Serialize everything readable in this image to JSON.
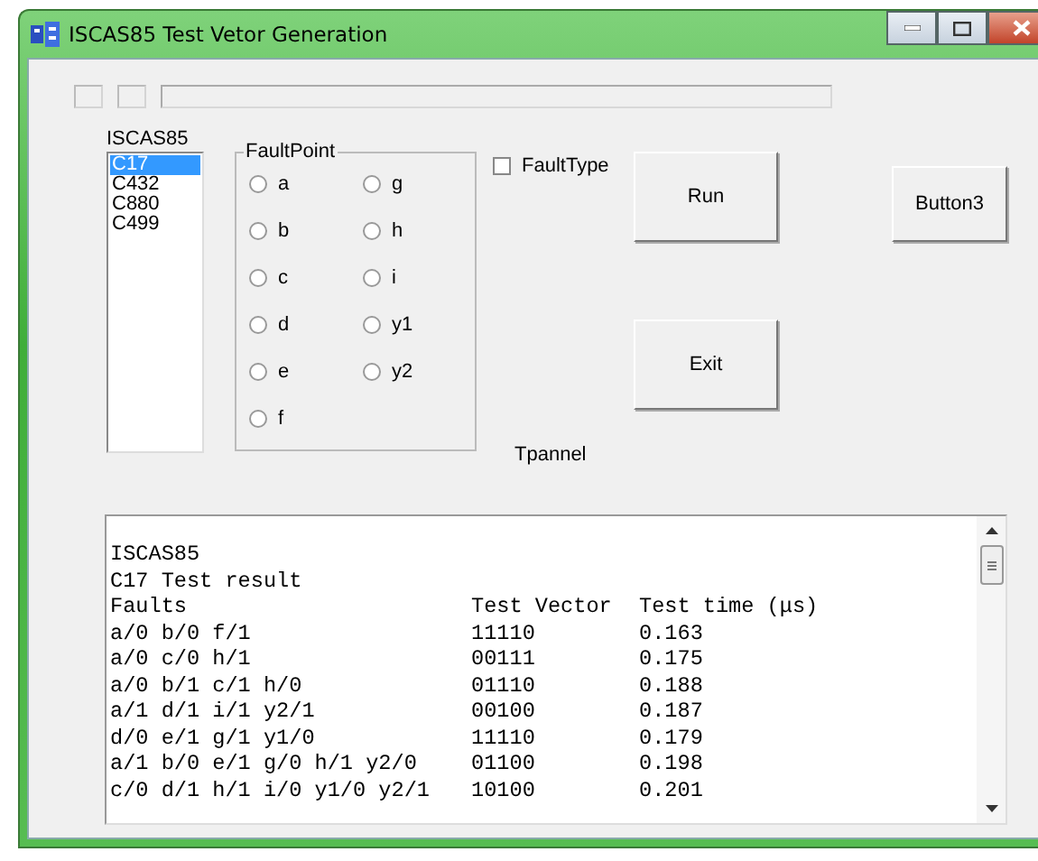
{
  "window": {
    "title": "ISCAS85 Test Vetor Generation"
  },
  "circuit_list": {
    "label": "ISCAS85",
    "items": [
      {
        "label": "C17",
        "selected": true
      },
      {
        "label": "C432",
        "selected": false
      },
      {
        "label": "C880",
        "selected": false
      },
      {
        "label": "C499",
        "selected": false
      }
    ]
  },
  "fault_point": {
    "title": "FaultPoint",
    "options": [
      {
        "label": "a",
        "selected": false
      },
      {
        "label": "g",
        "selected": false
      },
      {
        "label": "b",
        "selected": false
      },
      {
        "label": "h",
        "selected": false
      },
      {
        "label": "c",
        "selected": false
      },
      {
        "label": "i",
        "selected": false
      },
      {
        "label": "d",
        "selected": false
      },
      {
        "label": "y1",
        "selected": false
      },
      {
        "label": "e",
        "selected": false
      },
      {
        "label": "y2",
        "selected": false
      },
      {
        "label": "f",
        "selected": false
      }
    ]
  },
  "fault_type": {
    "label": "FaultType",
    "checked": false
  },
  "buttons": {
    "run": "Run",
    "exit": "Exit",
    "button3": "Button3"
  },
  "panel_label": "Tpannel",
  "output": {
    "lines": [
      "ISCAS85",
      "C17 Test result"
    ],
    "columns": [
      "Faults",
      "Test Vector",
      "Test time (μs)"
    ],
    "rows": [
      {
        "faults": "a/0 b/0 f/1",
        "vector": "11110",
        "time": "0.163"
      },
      {
        "faults": "a/0 c/0 h/1",
        "vector": "00111",
        "time": "0.175"
      },
      {
        "faults": "a/0 b/1 c/1 h/0",
        "vector": "01110",
        "time": "0.188"
      },
      {
        "faults": "a/1 d/1 i/1 y2/1",
        "vector": "00100",
        "time": "0.187"
      },
      {
        "faults": "d/0 e/1 g/1 y1/0",
        "vector": "11110",
        "time": "0.179"
      },
      {
        "faults": "a/1 b/0 e/1 g/0 h/1 y2/0",
        "vector": "01100",
        "time": "0.198"
      },
      {
        "faults": "c/0 d/1 h/1 i/0 y1/0 y2/1",
        "vector": "10100",
        "time": "0.201"
      }
    ]
  }
}
